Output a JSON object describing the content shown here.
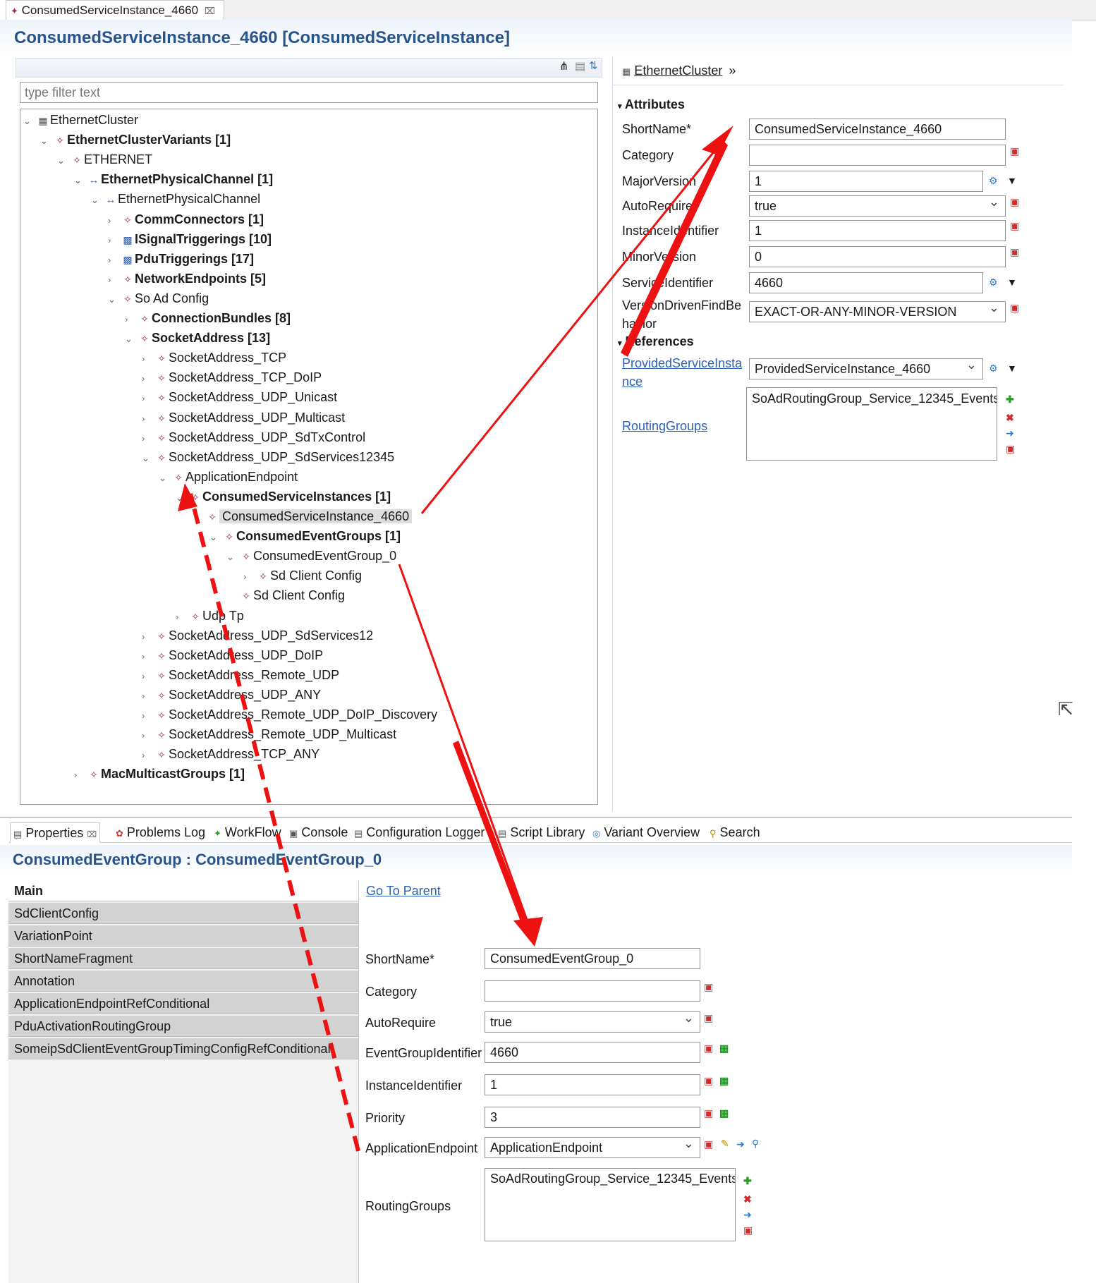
{
  "editor": {
    "tab_label": "ConsumedServiceInstance_4660",
    "title": "ConsumedServiceInstance_4660 [ConsumedServiceInstance]"
  },
  "tree": {
    "filter_placeholder": "type filter text",
    "nodes": [
      {
        "label": "EthernetCluster",
        "bold": false,
        "twisty": "open",
        "icon": "cluster-icon"
      },
      {
        "label": "EthernetClusterVariants [1]",
        "bold": true,
        "twisty": "open",
        "icon": "element-icon"
      },
      {
        "label": "ETHERNET",
        "bold": false,
        "twisty": "open",
        "icon": "element-icon"
      },
      {
        "label": "EthernetPhysicalChannel [1]",
        "bold": true,
        "twisty": "open",
        "icon": "channel-icon"
      },
      {
        "label": "EthernetPhysicalChannel",
        "bold": false,
        "twisty": "open",
        "icon": "channel-icon"
      },
      {
        "label": "CommConnectors [1]",
        "bold": true,
        "twisty": "closed",
        "icon": "element-icon"
      },
      {
        "label": "ISignalTriggerings [10]",
        "bold": true,
        "twisty": "closed",
        "icon": "triggering-icon"
      },
      {
        "label": "PduTriggerings [17]",
        "bold": true,
        "twisty": "closed",
        "icon": "triggering-icon"
      },
      {
        "label": "NetworkEndpoints [5]",
        "bold": true,
        "twisty": "closed",
        "icon": "element-icon"
      },
      {
        "label": "So Ad Config",
        "bold": false,
        "twisty": "open",
        "icon": "element-icon"
      },
      {
        "label": "ConnectionBundles [8]",
        "bold": true,
        "twisty": "closed",
        "icon": "element-icon"
      },
      {
        "label": "SocketAddress [13]",
        "bold": true,
        "twisty": "open",
        "icon": "element-icon"
      },
      {
        "label": "SocketAddress_TCP",
        "bold": false,
        "twisty": "closed",
        "icon": "element-icon"
      },
      {
        "label": "SocketAddress_TCP_DoIP",
        "bold": false,
        "twisty": "closed",
        "icon": "element-icon"
      },
      {
        "label": "SocketAddress_UDP_Unicast",
        "bold": false,
        "twisty": "closed",
        "icon": "element-icon"
      },
      {
        "label": "SocketAddress_UDP_Multicast",
        "bold": false,
        "twisty": "closed",
        "icon": "element-icon"
      },
      {
        "label": "SocketAddress_UDP_SdTxControl",
        "bold": false,
        "twisty": "closed",
        "icon": "element-icon"
      },
      {
        "label": "SocketAddress_UDP_SdServices12345",
        "bold": false,
        "twisty": "open",
        "icon": "element-icon"
      },
      {
        "label": "ApplicationEndpoint",
        "bold": false,
        "twisty": "open",
        "icon": "element-icon"
      },
      {
        "label": "ConsumedServiceInstances [1]",
        "bold": true,
        "twisty": "open",
        "icon": "element-icon"
      },
      {
        "label": "ConsumedServiceInstance_4660",
        "bold": false,
        "twisty": "open",
        "icon": "element-icon",
        "selected": true
      },
      {
        "label": "ConsumedEventGroups [1]",
        "bold": true,
        "twisty": "open",
        "icon": "element-icon"
      },
      {
        "label": "ConsumedEventGroup_0",
        "bold": false,
        "twisty": "open",
        "icon": "element-icon"
      },
      {
        "label": "Sd Client Config",
        "bold": false,
        "twisty": "closed",
        "icon": "element-icon"
      },
      {
        "label": "Sd Client Config",
        "bold": false,
        "twisty": "none",
        "icon": "element-icon"
      },
      {
        "label": "Udp Tp",
        "bold": false,
        "twisty": "closed",
        "icon": "element-icon"
      },
      {
        "label": "SocketAddress_UDP_SdServices12",
        "bold": false,
        "twisty": "closed",
        "icon": "element-icon"
      },
      {
        "label": "SocketAddress_UDP_DoIP",
        "bold": false,
        "twisty": "closed",
        "icon": "element-icon"
      },
      {
        "label": "SocketAddress_Remote_UDP",
        "bold": false,
        "twisty": "closed",
        "icon": "element-icon"
      },
      {
        "label": "SocketAddress_UDP_ANY",
        "bold": false,
        "twisty": "closed",
        "icon": "element-icon"
      },
      {
        "label": "SocketAddress_Remote_UDP_DoIP_Discovery",
        "bold": false,
        "twisty": "closed",
        "icon": "element-icon"
      },
      {
        "label": "SocketAddress_Remote_UDP_Multicast",
        "bold": false,
        "twisty": "closed",
        "icon": "element-icon"
      },
      {
        "label": "SocketAddress_TCP_ANY",
        "bold": false,
        "twisty": "closed",
        "icon": "element-icon"
      },
      {
        "label": "MacMulticastGroups [1]",
        "bold": true,
        "twisty": "closed",
        "icon": "element-icon"
      }
    ]
  },
  "attributes_panel": {
    "breadcrumb": "EthernetCluster",
    "attributes_heading": "Attributes",
    "references_heading": "References",
    "fields": {
      "shortname": {
        "label": "ShortName*",
        "value": "ConsumedServiceInstance_4660"
      },
      "category": {
        "label": "Category",
        "value": ""
      },
      "major_version": {
        "label": "MajorVersion",
        "value": "1"
      },
      "auto_require": {
        "label": "AutoRequire",
        "value": "true"
      },
      "instance_identifier": {
        "label": "InstanceIdentifier",
        "value": "1"
      },
      "minor_version": {
        "label": "MinorVersion",
        "value": "0"
      },
      "service_identifier": {
        "label": "ServiceIdentifier",
        "value": "4660"
      },
      "version_driven": {
        "label_line1": "VersionDrivenFindBe",
        "label_line2": "havior",
        "value": "EXACT-OR-ANY-MINOR-VERSION"
      },
      "provided_service": {
        "label_line1": "ProvidedServiceInsta",
        "label_line2": "nce",
        "value": "ProvidedServiceInstance_4660"
      },
      "routing_groups": {
        "label": "RoutingGroups",
        "value": "SoAdRoutingGroup_Service_12345_Events"
      }
    }
  },
  "bottom_tabs": [
    "Properties",
    "Problems Log",
    "WorkFlow",
    "Console",
    "Configuration Logger",
    "Script Library",
    "Variant Overview",
    "Search"
  ],
  "properties": {
    "title": "ConsumedEventGroup : ConsumedEventGroup_0",
    "nav": [
      "Main",
      "SdClientConfig",
      "VariationPoint",
      "ShortNameFragment",
      "Annotation",
      "ApplicationEndpointRefConditional",
      "PduActivationRoutingGroup",
      "SomeipSdClientEventGroupTimingConfigRefConditional"
    ],
    "go_to_parent": "Go To Parent",
    "fields": {
      "shortname": {
        "label": "ShortName*",
        "value": "ConsumedEventGroup_0"
      },
      "category": {
        "label": "Category",
        "value": ""
      },
      "auto_require": {
        "label": "AutoRequire",
        "value": "true"
      },
      "event_group_identifier": {
        "label": "EventGroupIdentifier",
        "value": "4660"
      },
      "instance_identifier": {
        "label": "InstanceIdentifier",
        "value": "1"
      },
      "priority": {
        "label": "Priority",
        "value": "3"
      },
      "application_endpoint": {
        "label": "ApplicationEndpoint",
        "value": "ApplicationEndpoint"
      },
      "routing_groups": {
        "label": "RoutingGroups",
        "value": "SoAdRoutingGroup_Service_12345_Events"
      }
    }
  },
  "colors": {
    "title_blue": "#28548c",
    "link_blue": "#2a62b8",
    "annotation_red": "#ee1111"
  }
}
